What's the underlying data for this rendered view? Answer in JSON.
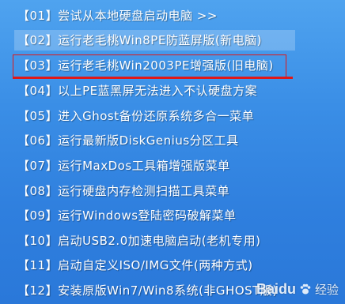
{
  "menu": {
    "items": [
      {
        "label": "【01】尝试从本地硬盘启动电脑 >>"
      },
      {
        "label": "【02】运行老毛桃Win8PE防蓝屏版(新电脑)"
      },
      {
        "label": "【03】运行老毛桃Win2003PE增强版(旧电脑)"
      },
      {
        "label": "【04】以上PE蓝黑屏无法进入不认硬盘方案"
      },
      {
        "label": "【05】进入Ghost备份还原系统多合一菜单"
      },
      {
        "label": "【06】运行最新版DiskGenius分区工具"
      },
      {
        "label": "【07】运行MaxDos工具箱增强版菜单"
      },
      {
        "label": "【08】运行硬盘内存检测扫描工具菜单"
      },
      {
        "label": "【09】运行Windows登陆密码破解菜单"
      },
      {
        "label": "【10】启动USB2.0加速电脑启动(老机专用)"
      },
      {
        "label": "【11】启动自定义ISO/IMG文件(两种方式)"
      },
      {
        "label": "【12】安装原版Win7/Win8系统(非GHOST版)"
      }
    ],
    "selected_index": 1,
    "highlighted_index": 2
  },
  "watermark": {
    "brand": "Baidu",
    "suffix": "经验",
    "icon": "paw-icon"
  },
  "colors": {
    "background": "#3a8ee6",
    "text": "#ffffff",
    "annotation_red": "#e01818"
  }
}
